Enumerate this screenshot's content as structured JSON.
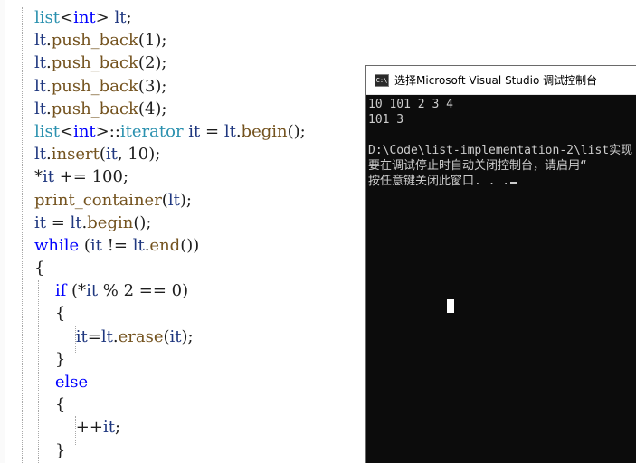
{
  "editor": {
    "lines": [
      [
        {
          "t": "list",
          "c": "ty"
        },
        {
          "t": "<",
          "c": "op"
        },
        {
          "t": "int",
          "c": "kw"
        },
        {
          "t": "> ",
          "c": "op"
        },
        {
          "t": "lt",
          "c": "var"
        },
        {
          "t": ";",
          "c": "op"
        }
      ],
      [
        {
          "t": "lt",
          "c": "var"
        },
        {
          "t": ".",
          "c": "op"
        },
        {
          "t": "push_back",
          "c": "fn"
        },
        {
          "t": "(1);",
          "c": "op"
        }
      ],
      [
        {
          "t": "lt",
          "c": "var"
        },
        {
          "t": ".",
          "c": "op"
        },
        {
          "t": "push_back",
          "c": "fn"
        },
        {
          "t": "(2);",
          "c": "op"
        }
      ],
      [
        {
          "t": "lt",
          "c": "var"
        },
        {
          "t": ".",
          "c": "op"
        },
        {
          "t": "push_back",
          "c": "fn"
        },
        {
          "t": "(3);",
          "c": "op"
        }
      ],
      [
        {
          "t": "lt",
          "c": "var"
        },
        {
          "t": ".",
          "c": "op"
        },
        {
          "t": "push_back",
          "c": "fn"
        },
        {
          "t": "(4);",
          "c": "op"
        }
      ],
      [
        {
          "t": "list",
          "c": "ty"
        },
        {
          "t": "<",
          "c": "op"
        },
        {
          "t": "int",
          "c": "kw"
        },
        {
          "t": ">::",
          "c": "op"
        },
        {
          "t": "iterator",
          "c": "ty"
        },
        {
          "t": " ",
          "c": "op"
        },
        {
          "t": "it",
          "c": "var"
        },
        {
          "t": " = ",
          "c": "op"
        },
        {
          "t": "lt",
          "c": "var"
        },
        {
          "t": ".",
          "c": "op"
        },
        {
          "t": "begin",
          "c": "fn"
        },
        {
          "t": "();",
          "c": "op"
        }
      ],
      [
        {
          "t": "lt",
          "c": "var"
        },
        {
          "t": ".",
          "c": "op"
        },
        {
          "t": "insert",
          "c": "fn"
        },
        {
          "t": "(",
          "c": "op"
        },
        {
          "t": "it",
          "c": "var"
        },
        {
          "t": ", 10);",
          "c": "op"
        }
      ],
      [
        {
          "t": "*",
          "c": "op"
        },
        {
          "t": "it",
          "c": "var"
        },
        {
          "t": " += 100;",
          "c": "op"
        }
      ],
      [
        {
          "t": "print_container",
          "c": "fn"
        },
        {
          "t": "(",
          "c": "op"
        },
        {
          "t": "lt",
          "c": "var"
        },
        {
          "t": ");",
          "c": "op"
        }
      ],
      [
        {
          "t": "it",
          "c": "var"
        },
        {
          "t": " = ",
          "c": "op"
        },
        {
          "t": "lt",
          "c": "var"
        },
        {
          "t": ".",
          "c": "op"
        },
        {
          "t": "begin",
          "c": "fn"
        },
        {
          "t": "();",
          "c": "op"
        }
      ],
      [
        {
          "t": "while",
          "c": "kw"
        },
        {
          "t": " (",
          "c": "op"
        },
        {
          "t": "it",
          "c": "var"
        },
        {
          "t": " != ",
          "c": "op"
        },
        {
          "t": "lt",
          "c": "var"
        },
        {
          "t": ".",
          "c": "op"
        },
        {
          "t": "end",
          "c": "fn"
        },
        {
          "t": "())",
          "c": "op"
        }
      ],
      [
        {
          "t": "{",
          "c": "op"
        }
      ],
      [
        {
          "t": "    "
        },
        {
          "t": "if",
          "c": "kw"
        },
        {
          "t": " (*",
          "c": "op"
        },
        {
          "t": "it",
          "c": "var"
        },
        {
          "t": " % 2 == 0)",
          "c": "op"
        }
      ],
      [
        {
          "t": "    "
        },
        {
          "t": "{",
          "c": "op"
        }
      ],
      [
        {
          "t": "        "
        },
        {
          "t": "it",
          "c": "var"
        },
        {
          "t": "=",
          "c": "op"
        },
        {
          "t": "lt",
          "c": "var"
        },
        {
          "t": ".",
          "c": "op"
        },
        {
          "t": "erase",
          "c": "fn"
        },
        {
          "t": "(",
          "c": "op"
        },
        {
          "t": "it",
          "c": "var"
        },
        {
          "t": ");",
          "c": "op"
        }
      ],
      [
        {
          "t": "    "
        },
        {
          "t": "}",
          "c": "op"
        }
      ],
      [
        {
          "t": "    "
        },
        {
          "t": "else",
          "c": "kw"
        }
      ],
      [
        {
          "t": "    "
        },
        {
          "t": "{",
          "c": "op"
        }
      ],
      [
        {
          "t": "        "
        },
        {
          "t": "++",
          "c": "op"
        },
        {
          "t": "it",
          "c": "var"
        },
        {
          "t": ";",
          "c": "op"
        }
      ],
      [
        {
          "t": "    "
        },
        {
          "t": "}",
          "c": "op"
        }
      ]
    ]
  },
  "console": {
    "title": "选择Microsoft Visual Studio 调试控制台",
    "icon_label": "C:\\",
    "icon": "console-app-icon",
    "output": [
      "10 101 2 3 4",
      "101 3",
      "",
      "D:\\Code\\list-implementation-2\\list实现",
      "要在调试停止时自动关闭控制台，请启用“",
      "按任意键关闭此窗口. . ."
    ]
  },
  "colors": {
    "keyword": "#0000ff",
    "type": "#2b91af",
    "function": "#74531f",
    "variable": "#1f377f",
    "console_bg": "#0c0c0c",
    "console_text": "#cccccc"
  }
}
